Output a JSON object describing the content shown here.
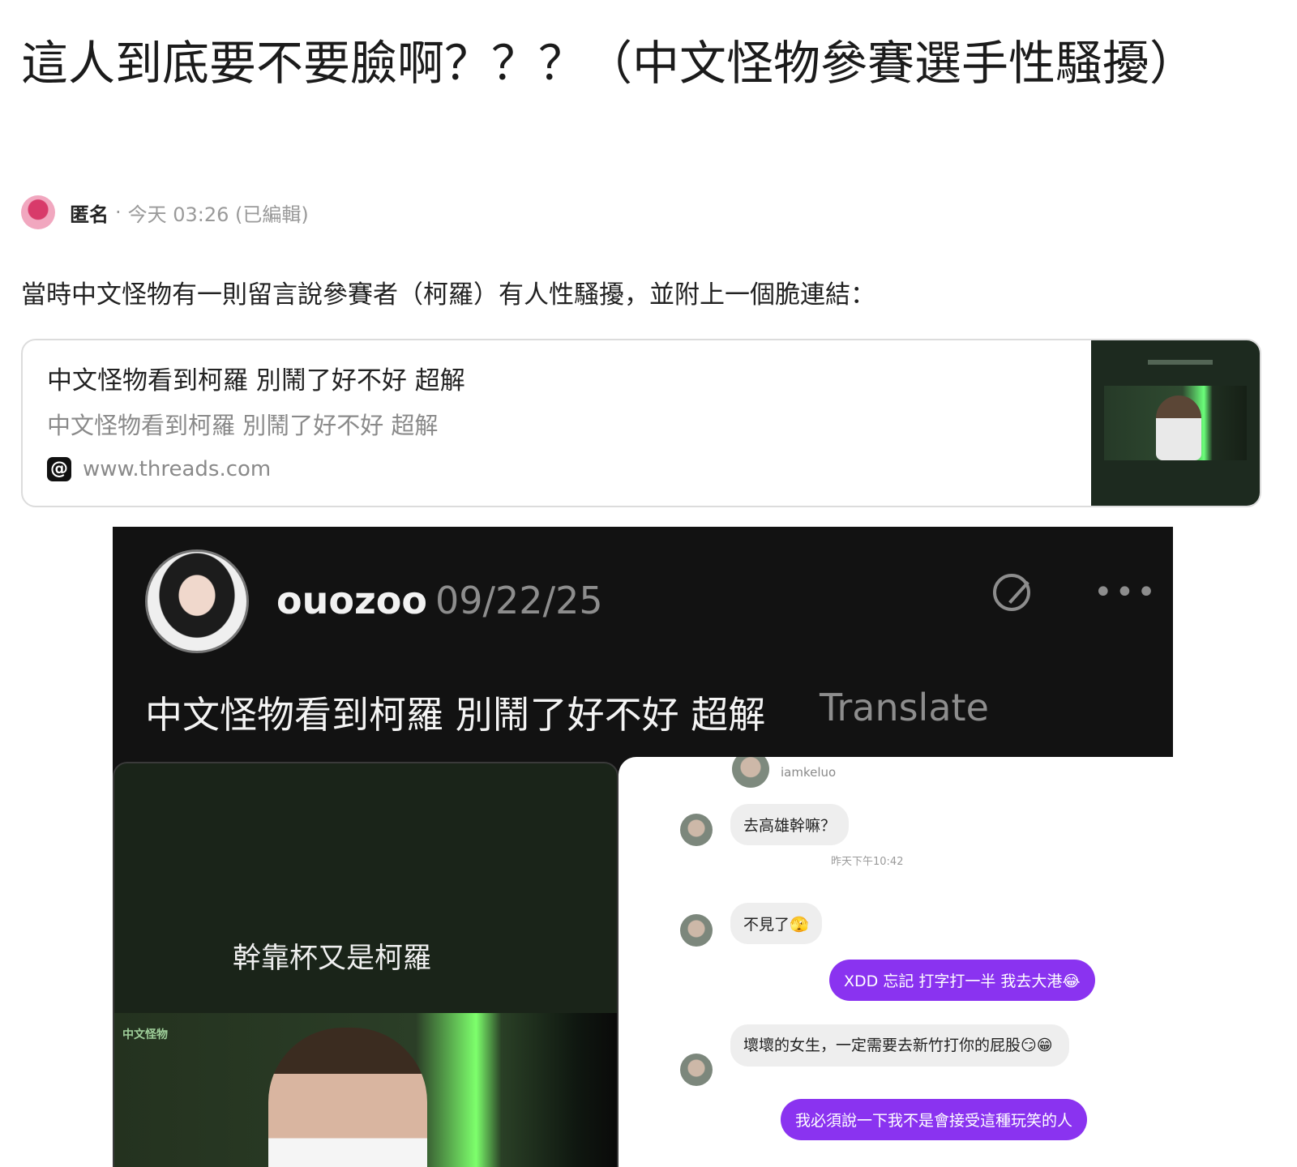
{
  "post": {
    "title": "這人到底要不要臉啊？？？（中文怪物參賽選手性騷擾）",
    "author": "匿名",
    "separator": "·",
    "time": "今天 03:26 (已編輯)",
    "body": "當時中文怪物有一則留言說參賽者（柯羅）有人性騷擾，並附上一個脆連結："
  },
  "link_card": {
    "title": "中文怪物看到柯羅 別鬧了好不好 超解",
    "description": "中文怪物看到柯羅 別鬧了好不好 超解",
    "site_icon": "@",
    "url": "www.threads.com"
  },
  "screenshot": {
    "username": "ouozoo",
    "date": "09/22/25",
    "more": "•••",
    "caption": "中文怪物看到柯羅 別鬧了好不好 超解",
    "translate": "Translate",
    "video": {
      "caption": "幹靠杯又是柯羅",
      "logo": "中文怪物"
    },
    "chat": {
      "handle": "iamkeluo",
      "time": "昨天下午10:42",
      "messages": [
        {
          "side": "in",
          "text": "去高雄幹嘛？"
        },
        {
          "side": "in",
          "text": "不見了🫣"
        },
        {
          "side": "out",
          "text": "XDD 忘記 打字打一半 我去大港😂"
        },
        {
          "side": "in",
          "text": "壞壞的女生，一定需要去新竹打你的屁股😏😁"
        },
        {
          "side": "out",
          "text": "我必須說一下我不是會接受這種玩笑的人"
        }
      ]
    }
  }
}
